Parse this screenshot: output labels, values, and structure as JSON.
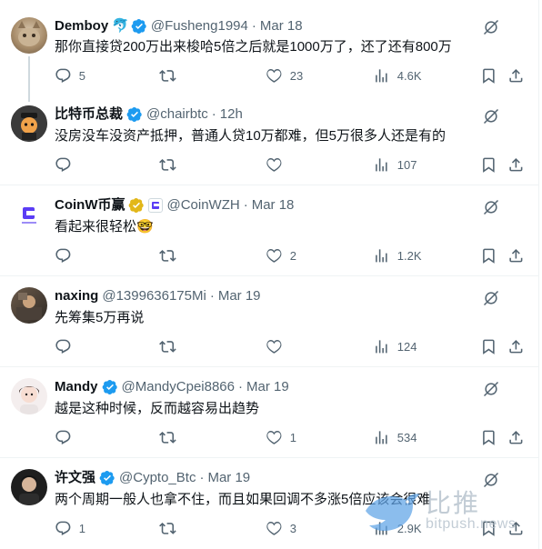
{
  "tweets": [
    {
      "name": "Demboy",
      "emoji": "🐬",
      "handle": "@Fusheng1994",
      "time": "Mar 18",
      "text": "那你直接贷200万出来梭哈5倍之后就是1000万了，还了还有800万",
      "reply_count": "5",
      "retweet_count": "",
      "like_count": "23",
      "views": "4.6K",
      "verified": true
    },
    {
      "name": "比特币总裁",
      "handle": "@chairbtc",
      "time": "12h",
      "text": "没房没车没资产抵押，普通人贷10万都难，但5万很多人还是有的",
      "reply_count": "",
      "retweet_count": "",
      "like_count": "",
      "views": "107",
      "verified": true
    },
    {
      "name": "CoinW币赢",
      "handle": "@CoinWZH",
      "time": "Mar 18",
      "text": "看起来很轻松🤓",
      "reply_count": "",
      "retweet_count": "",
      "like_count": "2",
      "views": "1.2K",
      "verified": true,
      "badge_color": "gold"
    },
    {
      "name": "naxing",
      "handle": "@1399636175Mi",
      "time": "Mar 19",
      "text": "先筹集5万再说",
      "reply_count": "",
      "retweet_count": "",
      "like_count": "",
      "views": "124",
      "verified": false
    },
    {
      "name": "Mandy",
      "handle": "@MandyCpei8866",
      "time": "Mar 19",
      "text": "越是这种时候，反而越容易出趋势",
      "reply_count": "",
      "retweet_count": "",
      "like_count": "1",
      "views": "534",
      "verified": true
    },
    {
      "name": "许文强",
      "handle": "@Cypto_Btc",
      "time": "Mar 19",
      "text": "两个周期一般人也拿不住，而且如果回调不多涨5倍应该会很难",
      "reply_count": "1",
      "retweet_count": "",
      "like_count": "3",
      "views": "2.9K",
      "verified": true
    }
  ],
  "separator_dot": "·",
  "watermark": {
    "cn": "比推",
    "en": "bitpush.news"
  },
  "colors": {
    "verified_blue": "#1d9bf0",
    "verified_gold": "#e2b719",
    "muted": "#536471",
    "text": "#0f1419",
    "border": "#eff3f4"
  },
  "icons": [
    "grok-icon",
    "reply-icon",
    "retweet-icon",
    "like-icon",
    "views-icon",
    "bookmark-icon",
    "share-icon",
    "verified-badge-icon"
  ]
}
